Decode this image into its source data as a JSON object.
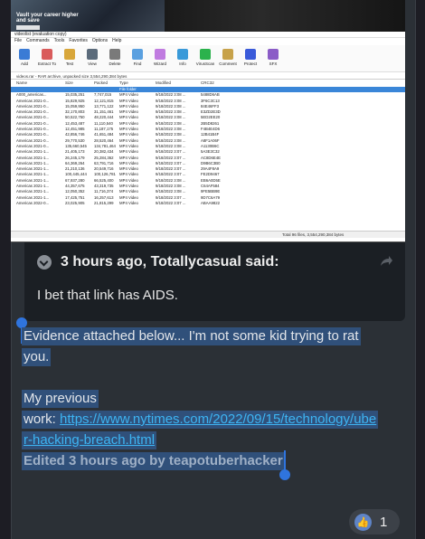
{
  "screenshot": {
    "game_banner": "Vault your career higher and save",
    "window_title": "videolist (evaluation copy)",
    "menu": [
      "File",
      "Commands",
      "Tools",
      "Favorites",
      "Options",
      "Help"
    ],
    "toolbar": [
      {
        "label": "Add",
        "color": "#3a7bd5"
      },
      {
        "label": "Extract To",
        "color": "#d95b5b"
      },
      {
        "label": "Test",
        "color": "#d8a63a"
      },
      {
        "label": "View",
        "color": "#5b6b7b"
      },
      {
        "label": "Delete",
        "color": "#7a7a7a"
      },
      {
        "label": "Find",
        "color": "#5aa0e0"
      },
      {
        "label": "Wizard",
        "color": "#c07be0"
      },
      {
        "label": "Info",
        "color": "#3a9ad9"
      },
      {
        "label": "VirusScan",
        "color": "#2bb24c"
      },
      {
        "label": "Comment",
        "color": "#c7a24a"
      },
      {
        "label": "Protect",
        "color": "#3a5ad9"
      },
      {
        "label": "SFX",
        "color": "#8b5cc7"
      }
    ],
    "path": "videos.rar - RAR archive, unpacked size 3,554,290,384 bytes",
    "columns": [
      "Name",
      "Size",
      "Packed",
      "Type",
      "Modified",
      "CRC32"
    ],
    "selected_row": "File folder",
    "rows": [
      [
        "A000_americas...",
        "15,035,251",
        "7,747,015",
        "MP4 Video",
        "9/18/2022 3:08 ...",
        "5488D6AB"
      ],
      [
        "Americas 2021-0...",
        "15,829,925",
        "12,121,815",
        "MP4 Video",
        "9/18/2022 3:08 ...",
        "3F6C3C13"
      ],
      [
        "Americas 2021-0...",
        "15,059,950",
        "13,771,122",
        "MP4 Video",
        "9/18/2022 3:08 ...",
        "84E46FF3"
      ],
      [
        "Americas 2021-0...",
        "32,170,803",
        "31,151,461",
        "MP4 Video",
        "9/18/2022 3:08 ...",
        "E3ZD2E3D"
      ],
      [
        "Americas 2021-0...",
        "50,522,750",
        "48,220,444",
        "MP4 Video",
        "9/18/2022 3:08 ...",
        "5ED2EE20"
      ],
      [
        "Americas 2021-0...",
        "12,453,487",
        "11,110,540",
        "MP4 Video",
        "9/18/2022 3:08 ...",
        "2B5D8261"
      ],
      [
        "Americas 2021-0...",
        "12,451,985",
        "11,187,175",
        "MP4 Video",
        "9/18/2022 3:08 ...",
        "F4B4E4D6"
      ],
      [
        "Americas 2021-0...",
        "42,856,746",
        "41,651,484",
        "MP4 Video",
        "9/18/2022 3:08 ...",
        "12B41B4F"
      ],
      [
        "Americas 2021-0...",
        "29,770,530",
        "28,520,464",
        "MP4 Video",
        "9/18/2022 3:08 ...",
        "A8F1A06F"
      ],
      [
        "Americas 2021-0...",
        "135,660,545",
        "134,781,464",
        "MP4 Video",
        "9/18/2022 3:08 ...",
        "A1130B6C"
      ],
      [
        "Americas 2021-1...",
        "21,405,173",
        "20,382,434",
        "MP4 Video",
        "9/18/2022 3:07 ...",
        "5A3E3C32"
      ],
      [
        "Americas 2021-1...",
        "26,245,179",
        "25,284,362",
        "MP4 Video",
        "9/18/2022 3:07 ...",
        "AC8D6E4E"
      ],
      [
        "Americas 2021-1...",
        "64,369,264",
        "63,791,716",
        "MP4 Video",
        "9/18/2022 3:07 ...",
        "D9B6C3B0"
      ],
      [
        "Americas 2021-1...",
        "21,210,136",
        "20,549,716",
        "MP4 Video",
        "9/18/2022 3:07 ...",
        "29A4F8A9"
      ],
      [
        "Americas 2021-1...",
        "100,445,444",
        "100,126,781",
        "MP4 Video",
        "9/18/2022 3:07 ...",
        "FE2D9467"
      ],
      [
        "Americas 2021-1...",
        "67,937,280",
        "66,525,400",
        "MP4 Video",
        "9/18/2022 3:08 ...",
        "EB6A0D5E"
      ],
      [
        "Americas 2021-1...",
        "44,357,675",
        "43,319,735",
        "MP4 Video",
        "9/18/2022 3:08 ...",
        "C64AF584"
      ],
      [
        "Americas 2021-1...",
        "12,050,352",
        "11,716,374",
        "MP4 Video",
        "9/18/2022 3:08 ...",
        "9FE5BB9E"
      ],
      [
        "Americas 2021-1...",
        "17,425,751",
        "16,257,613",
        "MP4 Video",
        "9/18/2022 3:07 ...",
        "9D7C6A79"
      ],
      [
        "Americas 2022-0...",
        "23,025,905",
        "21,815,299",
        "MP4 Video",
        "9/18/2022 3:07 ...",
        "ABAA9822"
      ]
    ],
    "status": "Total 96 files, 3,554,290,384 bytes"
  },
  "quote": {
    "header": "3 hours ago, Totallycasual said:",
    "body": "I bet that link has AIDS."
  },
  "post": {
    "line1": "Evidence attached below... I'm not some kid trying to rat",
    "line2": "you.",
    "line3": "My previous",
    "line4_prefix": "work: ",
    "link_part1": "https://www.nytimes.com/2022/09/15/technology/ube",
    "link_part2": "r-hacking-breach.html",
    "edited": "Edited 3 hours ago by teapotuberhacker"
  },
  "reactions": {
    "like_count": "1"
  },
  "colors": {
    "background": "#2b3036",
    "selection": "#30507a",
    "link": "#3db4f2",
    "handle": "#2f74de"
  }
}
